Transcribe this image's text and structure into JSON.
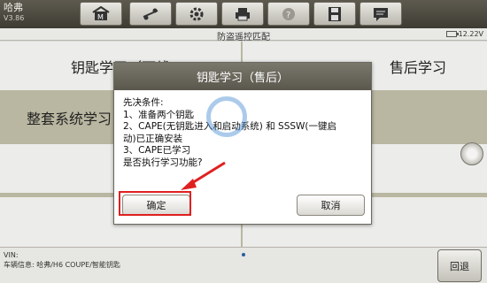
{
  "app": {
    "brand": "哈弗",
    "version": "V3.86"
  },
  "toolbar": {
    "buttons": [
      {
        "name": "home-icon"
      },
      {
        "name": "vehicle-swap-icon"
      },
      {
        "name": "gear-icon"
      },
      {
        "name": "printer-icon"
      },
      {
        "name": "help-icon"
      },
      {
        "name": "save-icon"
      },
      {
        "name": "message-icon"
      }
    ]
  },
  "status": {
    "title": "防盗遥控匹配",
    "battery": "12.22V"
  },
  "menu": {
    "key_learning": "钥匙学习（下线",
    "after_sales_learning": "售后学习",
    "full_system_learning": "整套系统学习"
  },
  "dialog": {
    "title": "钥匙学习（售后）",
    "lines": [
      "先决条件:",
      "1、准备两个钥匙",
      "2、CAPE(无钥匙进入和启动系统) 和 SSSW(一键启",
      "动)已正确安装",
      "3、CAPE已学习",
      "是否执行学习功能?"
    ],
    "ok_label": "确定",
    "cancel_label": "取消"
  },
  "footer": {
    "vin_label": "VIN:",
    "vehicle_info": "车辆信息: 哈弗/H6 COUPE/智能钥匙",
    "back_label": "回退"
  },
  "colors": {
    "highlight": "#e02020",
    "dialog_header": "#6a675c"
  }
}
